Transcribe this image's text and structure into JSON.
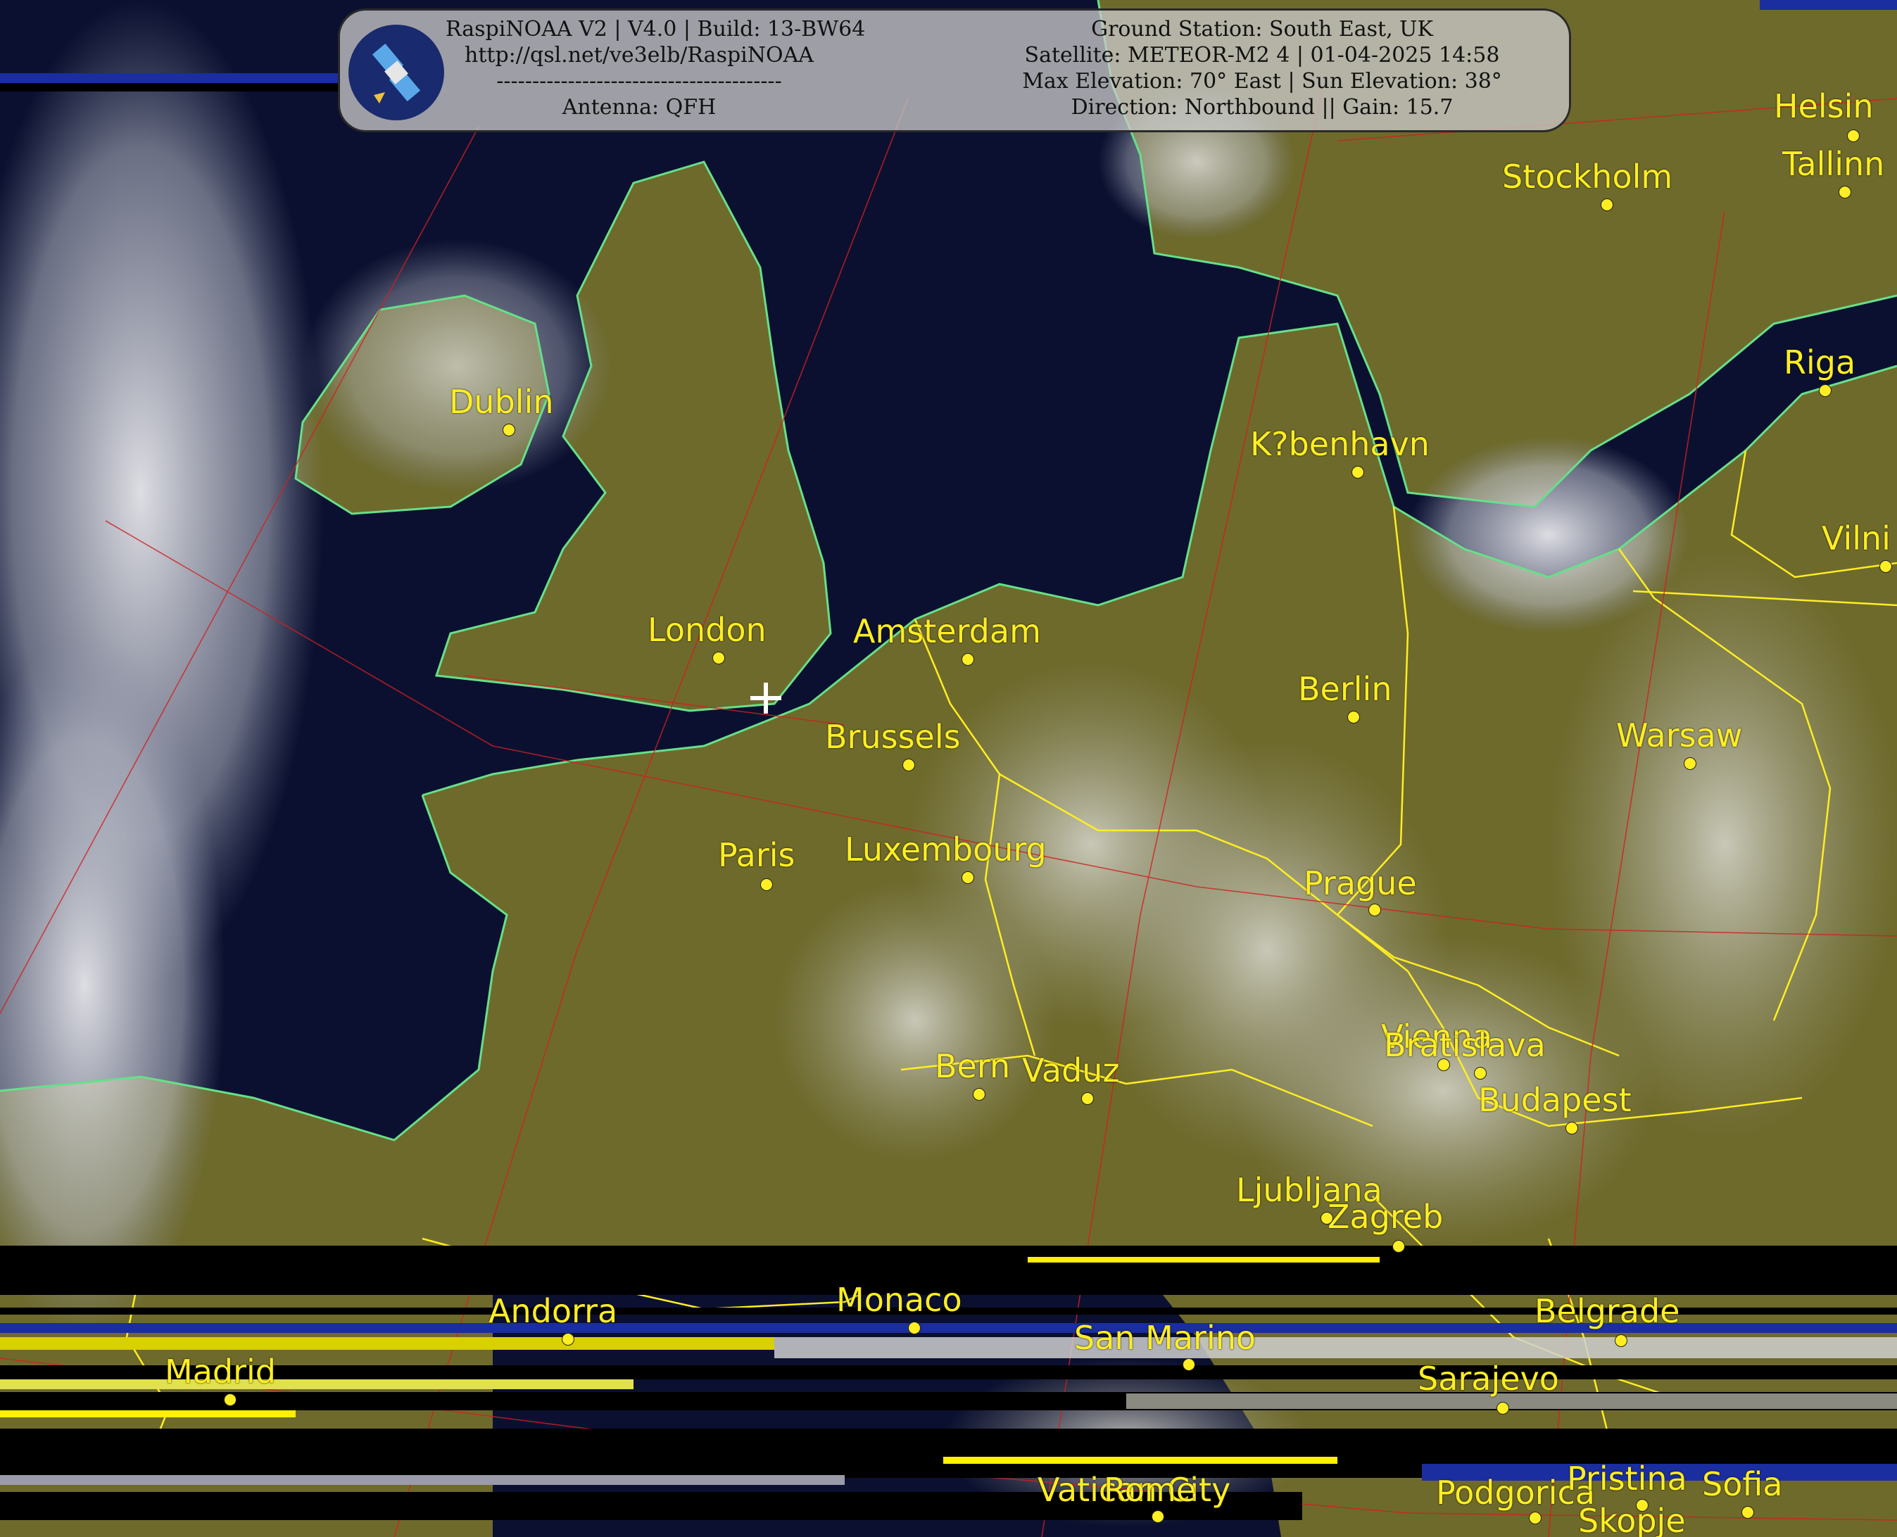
{
  "header": {
    "left_lines": [
      "RaspiNOAA V2 | V4.0 | Build: 13-BW64",
      "http://qsl.net/ve3elb/RaspiNOAA",
      "----------------------------------------",
      "Antenna: QFH"
    ],
    "right_lines": [
      "Ground Station: South East, UK",
      "Satellite: METEOR-M2 4 | 01-04-2025 14:58",
      "Max Elevation: 70° East | Sun Elevation: 38°",
      "Direction: Northbound || Gain: 15.7"
    ],
    "logo_icon": "satellite-icon"
  },
  "colors": {
    "label": "#ffee22",
    "border": "#ffee22",
    "coast": "#66e08a",
    "grid": "#d02020",
    "sea": "#0b1030",
    "land": "#6e6a2c"
  },
  "cities": [
    "Helsin",
    "Tallinn",
    "Stockholm",
    "Riga",
    "Dublin",
    "K?benhavn",
    "Vilni",
    "London",
    "Amsterdam",
    "Berlin",
    "Brussels",
    "Warsaw",
    "Paris",
    "Luxembourg",
    "Prague",
    "Vienna",
    "Bratislava",
    "Bern",
    "Vaduz",
    "Budapest",
    "Ljubljana",
    "Zagreb",
    "Andorra",
    "Monaco",
    "Belgrade",
    "San Marino",
    "Madrid",
    "Sarajevo",
    "Vatican City",
    "Rome",
    "Podgorica",
    "Pristina",
    "Sofia",
    "Skopje"
  ]
}
